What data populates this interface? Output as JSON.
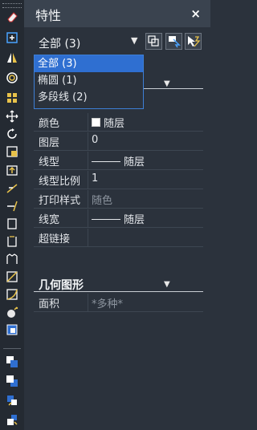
{
  "panel": {
    "title": "特性",
    "close_glyph": "×",
    "selection": {
      "value": "全部 (3)",
      "options": [
        "全部 (3)",
        "椭圆 (1)",
        "多段线 (2)"
      ],
      "selected_index": 0
    },
    "buttons": {
      "toggle_pickadd": "toggle-pickadd-icon",
      "select_objects": "select-objects-icon",
      "quick_select": "quick-select-icon"
    },
    "general": {
      "rows": [
        {
          "label": "颜色",
          "value": "随层",
          "has_swatch": true
        },
        {
          "label": "图层",
          "value": "0"
        },
        {
          "label": "线型",
          "value": "随层",
          "has_line": true
        },
        {
          "label": "线型比例",
          "value": "1"
        },
        {
          "label": "打印样式",
          "value": "随色",
          "dim": true
        },
        {
          "label": "线宽",
          "value": "随层",
          "has_line": true
        },
        {
          "label": "超链接",
          "value": ""
        }
      ]
    },
    "geometry": {
      "title": "几何图形",
      "rows": [
        {
          "label": "面积",
          "value": "*多种*",
          "dim": true
        }
      ]
    }
  },
  "toolbar": {
    "tools": [
      "erase-icon",
      "copy-icon",
      "mirror-icon",
      "offset-icon",
      "array-icon",
      "move-icon",
      "rotate-icon",
      "scale-icon",
      "stretch-icon",
      "trim-icon",
      "extend-icon",
      "break-at-point-icon",
      "break-icon",
      "join-icon",
      "chamfer-icon",
      "fillet-icon",
      "explode-icon",
      "draw-order-front-icon",
      "draw-order-back-icon",
      "bring-above-icon",
      "send-under-icon"
    ]
  }
}
